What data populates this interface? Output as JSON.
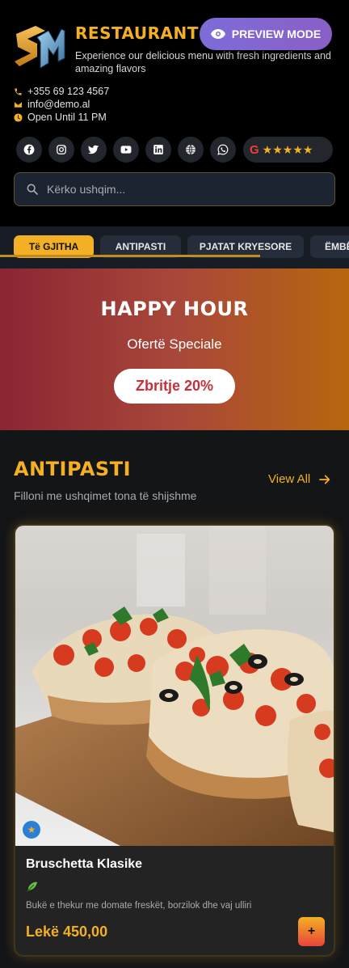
{
  "header": {
    "brand": "RESTAURANT DEMO",
    "tagline": "Experience our delicious menu with fresh ingredients and amazing flavors",
    "preview_label": "PREVIEW MODE",
    "contacts": {
      "phone": "+355 69 123 4567",
      "email": "info@demo.al",
      "hours": "Open Until 11 PM"
    },
    "socials": [
      "facebook-icon",
      "instagram-icon",
      "twitter-icon",
      "youtube-icon",
      "linkedin-icon",
      "website-icon",
      "whatsapp-icon"
    ],
    "google_rating": {
      "letter": "G",
      "stars": "★★★★★"
    }
  },
  "search": {
    "placeholder": "Kërko ushqim..."
  },
  "categories": [
    "Të GJITHA",
    "ANTIPASTI",
    "PJATAT KRYESORE",
    "ËMBËLSIRA"
  ],
  "banner": {
    "title": "HAPPY HOUR",
    "subtitle": "Ofertë Speciale",
    "button": "Zbritje 20%"
  },
  "section": {
    "title": "ANTIPASTI",
    "subtitle": "Filloni me ushqimet tona të shijshme",
    "view_all": "View All"
  },
  "card": {
    "name": "Bruschetta Klasike",
    "description": "Bukë e thekur me domate freskët, borzilok dhe vaj ulliri",
    "price": "Lekë 450,00",
    "add_label": "+"
  },
  "colors": {
    "accent": "#f3b024",
    "preview": "#7d6cd8",
    "banner_start": "#8a2633",
    "banner_end": "#b7660f"
  }
}
